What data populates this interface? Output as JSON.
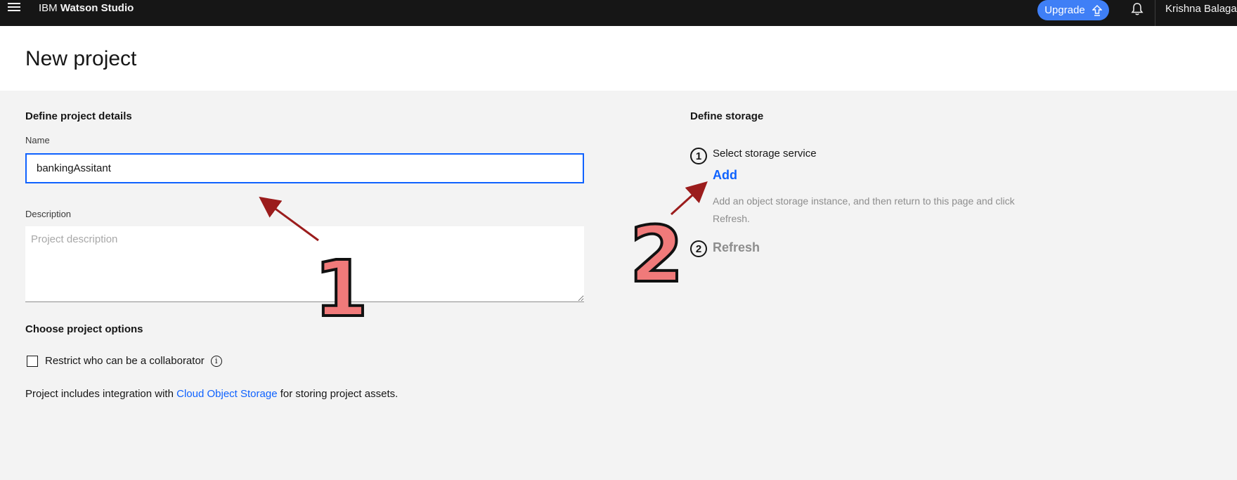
{
  "topbar": {
    "brand_prefix": "IBM",
    "brand_name": "Watson Studio",
    "upgrade_label": "Upgrade",
    "user_name": "Krishna Balaga's"
  },
  "header": {
    "title": "New project"
  },
  "details": {
    "heading": "Define project details",
    "name_label": "Name",
    "name_value": "bankingAssitant",
    "description_label": "Description",
    "description_placeholder": "Project description"
  },
  "options": {
    "heading": "Choose project options",
    "restrict_label": "Restrict who can be a collaborator",
    "integration_prefix": "Project includes integration with ",
    "integration_link": "Cloud Object Storage",
    "integration_suffix": " for storing project assets."
  },
  "storage": {
    "heading": "Define storage",
    "step1_number": "1",
    "step1_label": "Select storage service",
    "add_link": "Add",
    "help_text": "Add an object storage instance, and then return to this page and click Refresh.",
    "step2_number": "2",
    "refresh_link": "Refresh"
  },
  "annotations": {
    "marker_1": "1",
    "marker_2": "2",
    "arrow_color": "#9b1c1c",
    "marker_color": "#f07a7a"
  },
  "icons": [
    "hamburger-icon",
    "arrow-up-icon",
    "bell-icon",
    "info-icon"
  ]
}
